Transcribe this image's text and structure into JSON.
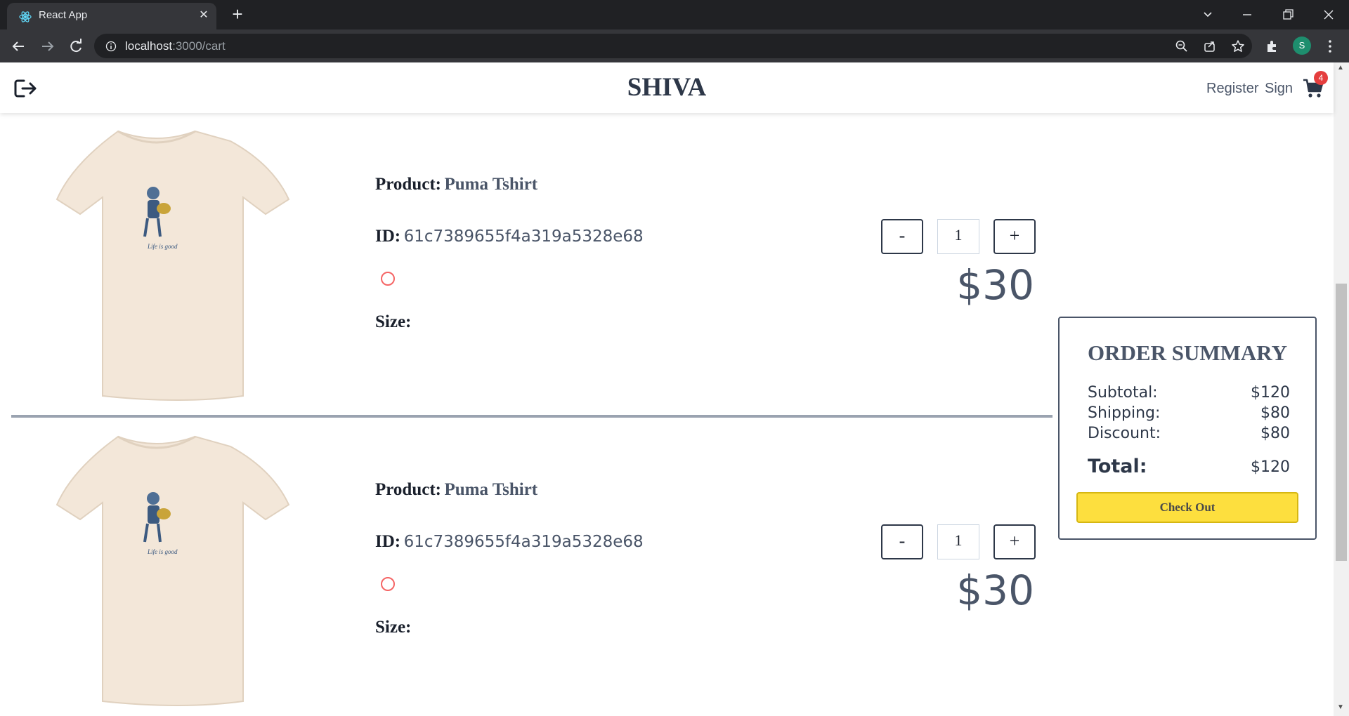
{
  "browser": {
    "tab_title": "React App",
    "tab_close": "✕",
    "new_tab": "+",
    "url_host": "localhost",
    "url_path": ":3000/cart",
    "profile_initial": "S"
  },
  "header": {
    "brand": "SHIVA",
    "register_label": "Register",
    "sign_label": "Sign",
    "cart_count": "4"
  },
  "items": [
    {
      "product_label": "Product:",
      "product_name": "Puma Tshirt",
      "id_label": "ID:",
      "id_value": "61c7389655f4a319a5328e68",
      "size_label": "Size:",
      "minus": "-",
      "quantity": "1",
      "plus": "+",
      "price": "$30",
      "color_ring": "#f56565"
    },
    {
      "product_label": "Product:",
      "product_name": "Puma Tshirt",
      "id_label": "ID:",
      "id_value": "61c7389655f4a319a5328e68",
      "size_label": "Size:",
      "minus": "-",
      "quantity": "1",
      "plus": "+",
      "price": "$30",
      "color_ring": "#f56565"
    }
  ],
  "summary": {
    "title": "ORDER SUMMARY",
    "subtotal_label": "Subtotal:",
    "subtotal_value": "$120",
    "shipping_label": "Shipping:",
    "shipping_value": "$80",
    "discount_label": "Discount:",
    "discount_value": "$80",
    "total_label": "Total:",
    "total_value": "$120",
    "checkout_label": "Check Out"
  },
  "colors": {
    "checkout_bg": "#fddf3e",
    "cart_badge": "#e53e3e",
    "brand_text": "#2d3748"
  },
  "icons": [
    "react-favicon",
    "back-arrow-icon",
    "forward-arrow-icon",
    "reload-icon",
    "info-icon",
    "zoom-icon",
    "share-icon",
    "star-icon",
    "extensions-icon",
    "menu-dots-icon",
    "logout-icon",
    "cart-icon",
    "color-swatch-icon"
  ]
}
